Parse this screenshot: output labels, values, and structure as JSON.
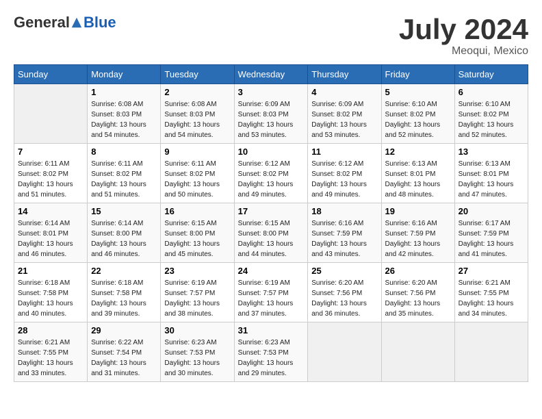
{
  "header": {
    "logo": {
      "general": "General",
      "blue": "Blue"
    },
    "month": "July 2024",
    "location": "Meoqui, Mexico"
  },
  "columns": [
    "Sunday",
    "Monday",
    "Tuesday",
    "Wednesday",
    "Thursday",
    "Friday",
    "Saturday"
  ],
  "weeks": [
    [
      {
        "day": null,
        "sunrise": null,
        "sunset": null,
        "daylight": null
      },
      {
        "day": "1",
        "sunrise": "Sunrise: 6:08 AM",
        "sunset": "Sunset: 8:03 PM",
        "daylight": "Daylight: 13 hours and 54 minutes."
      },
      {
        "day": "2",
        "sunrise": "Sunrise: 6:08 AM",
        "sunset": "Sunset: 8:03 PM",
        "daylight": "Daylight: 13 hours and 54 minutes."
      },
      {
        "day": "3",
        "sunrise": "Sunrise: 6:09 AM",
        "sunset": "Sunset: 8:03 PM",
        "daylight": "Daylight: 13 hours and 53 minutes."
      },
      {
        "day": "4",
        "sunrise": "Sunrise: 6:09 AM",
        "sunset": "Sunset: 8:02 PM",
        "daylight": "Daylight: 13 hours and 53 minutes."
      },
      {
        "day": "5",
        "sunrise": "Sunrise: 6:10 AM",
        "sunset": "Sunset: 8:02 PM",
        "daylight": "Daylight: 13 hours and 52 minutes."
      },
      {
        "day": "6",
        "sunrise": "Sunrise: 6:10 AM",
        "sunset": "Sunset: 8:02 PM",
        "daylight": "Daylight: 13 hours and 52 minutes."
      }
    ],
    [
      {
        "day": "7",
        "sunrise": "Sunrise: 6:11 AM",
        "sunset": "Sunset: 8:02 PM",
        "daylight": "Daylight: 13 hours and 51 minutes."
      },
      {
        "day": "8",
        "sunrise": "Sunrise: 6:11 AM",
        "sunset": "Sunset: 8:02 PM",
        "daylight": "Daylight: 13 hours and 51 minutes."
      },
      {
        "day": "9",
        "sunrise": "Sunrise: 6:11 AM",
        "sunset": "Sunset: 8:02 PM",
        "daylight": "Daylight: 13 hours and 50 minutes."
      },
      {
        "day": "10",
        "sunrise": "Sunrise: 6:12 AM",
        "sunset": "Sunset: 8:02 PM",
        "daylight": "Daylight: 13 hours and 49 minutes."
      },
      {
        "day": "11",
        "sunrise": "Sunrise: 6:12 AM",
        "sunset": "Sunset: 8:02 PM",
        "daylight": "Daylight: 13 hours and 49 minutes."
      },
      {
        "day": "12",
        "sunrise": "Sunrise: 6:13 AM",
        "sunset": "Sunset: 8:01 PM",
        "daylight": "Daylight: 13 hours and 48 minutes."
      },
      {
        "day": "13",
        "sunrise": "Sunrise: 6:13 AM",
        "sunset": "Sunset: 8:01 PM",
        "daylight": "Daylight: 13 hours and 47 minutes."
      }
    ],
    [
      {
        "day": "14",
        "sunrise": "Sunrise: 6:14 AM",
        "sunset": "Sunset: 8:01 PM",
        "daylight": "Daylight: 13 hours and 46 minutes."
      },
      {
        "day": "15",
        "sunrise": "Sunrise: 6:14 AM",
        "sunset": "Sunset: 8:00 PM",
        "daylight": "Daylight: 13 hours and 46 minutes."
      },
      {
        "day": "16",
        "sunrise": "Sunrise: 6:15 AM",
        "sunset": "Sunset: 8:00 PM",
        "daylight": "Daylight: 13 hours and 45 minutes."
      },
      {
        "day": "17",
        "sunrise": "Sunrise: 6:15 AM",
        "sunset": "Sunset: 8:00 PM",
        "daylight": "Daylight: 13 hours and 44 minutes."
      },
      {
        "day": "18",
        "sunrise": "Sunrise: 6:16 AM",
        "sunset": "Sunset: 7:59 PM",
        "daylight": "Daylight: 13 hours and 43 minutes."
      },
      {
        "day": "19",
        "sunrise": "Sunrise: 6:16 AM",
        "sunset": "Sunset: 7:59 PM",
        "daylight": "Daylight: 13 hours and 42 minutes."
      },
      {
        "day": "20",
        "sunrise": "Sunrise: 6:17 AM",
        "sunset": "Sunset: 7:59 PM",
        "daylight": "Daylight: 13 hours and 41 minutes."
      }
    ],
    [
      {
        "day": "21",
        "sunrise": "Sunrise: 6:18 AM",
        "sunset": "Sunset: 7:58 PM",
        "daylight": "Daylight: 13 hours and 40 minutes."
      },
      {
        "day": "22",
        "sunrise": "Sunrise: 6:18 AM",
        "sunset": "Sunset: 7:58 PM",
        "daylight": "Daylight: 13 hours and 39 minutes."
      },
      {
        "day": "23",
        "sunrise": "Sunrise: 6:19 AM",
        "sunset": "Sunset: 7:57 PM",
        "daylight": "Daylight: 13 hours and 38 minutes."
      },
      {
        "day": "24",
        "sunrise": "Sunrise: 6:19 AM",
        "sunset": "Sunset: 7:57 PM",
        "daylight": "Daylight: 13 hours and 37 minutes."
      },
      {
        "day": "25",
        "sunrise": "Sunrise: 6:20 AM",
        "sunset": "Sunset: 7:56 PM",
        "daylight": "Daylight: 13 hours and 36 minutes."
      },
      {
        "day": "26",
        "sunrise": "Sunrise: 6:20 AM",
        "sunset": "Sunset: 7:56 PM",
        "daylight": "Daylight: 13 hours and 35 minutes."
      },
      {
        "day": "27",
        "sunrise": "Sunrise: 6:21 AM",
        "sunset": "Sunset: 7:55 PM",
        "daylight": "Daylight: 13 hours and 34 minutes."
      }
    ],
    [
      {
        "day": "28",
        "sunrise": "Sunrise: 6:21 AM",
        "sunset": "Sunset: 7:55 PM",
        "daylight": "Daylight: 13 hours and 33 minutes."
      },
      {
        "day": "29",
        "sunrise": "Sunrise: 6:22 AM",
        "sunset": "Sunset: 7:54 PM",
        "daylight": "Daylight: 13 hours and 31 minutes."
      },
      {
        "day": "30",
        "sunrise": "Sunrise: 6:23 AM",
        "sunset": "Sunset: 7:53 PM",
        "daylight": "Daylight: 13 hours and 30 minutes."
      },
      {
        "day": "31",
        "sunrise": "Sunrise: 6:23 AM",
        "sunset": "Sunset: 7:53 PM",
        "daylight": "Daylight: 13 hours and 29 minutes."
      },
      {
        "day": null,
        "sunrise": null,
        "sunset": null,
        "daylight": null
      },
      {
        "day": null,
        "sunrise": null,
        "sunset": null,
        "daylight": null
      },
      {
        "day": null,
        "sunrise": null,
        "sunset": null,
        "daylight": null
      }
    ]
  ]
}
